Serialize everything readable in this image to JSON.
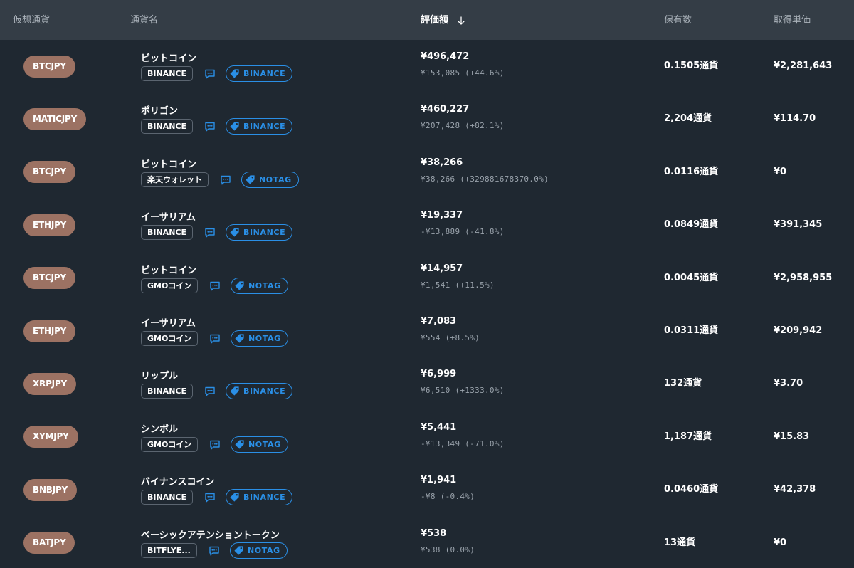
{
  "header": {
    "col_asset": "仮想通貨",
    "col_name": "通貨名",
    "col_value": "評価額",
    "col_qty": "保有数",
    "col_price": "取得単価"
  },
  "colors": {
    "header_bg": "#343d46",
    "body_bg": "#1f2831",
    "pill": "#9c7263",
    "tag_blue": "#2a8fe6"
  },
  "rows": [
    {
      "symbol": "BTCJPY",
      "name": "ビットコイン",
      "exchange": "BINANCE",
      "tag": "BINANCE",
      "value": "¥496,472",
      "gain": "¥153,085 (+44.6%)",
      "qty": "0.1505通貨",
      "price": "¥2,281,643"
    },
    {
      "symbol": "MATICJPY",
      "name": "ポリゴン",
      "exchange": "BINANCE",
      "tag": "BINANCE",
      "value": "¥460,227",
      "gain": "¥207,428 (+82.1%)",
      "qty": "2,204通貨",
      "price": "¥114.70"
    },
    {
      "symbol": "BTCJPY",
      "name": "ビットコイン",
      "exchange": "楽天ウォレット",
      "tag": "NOTAG",
      "value": "¥38,266",
      "gain": "¥38,266 (+329881678370.0%)",
      "qty": "0.0116通貨",
      "price": "¥0"
    },
    {
      "symbol": "ETHJPY",
      "name": "イーサリアム",
      "exchange": "BINANCE",
      "tag": "BINANCE",
      "value": "¥19,337",
      "gain": "-¥13,889 (-41.8%)",
      "qty": "0.0849通貨",
      "price": "¥391,345"
    },
    {
      "symbol": "BTCJPY",
      "name": "ビットコイン",
      "exchange": "GMOコイン",
      "tag": "NOTAG",
      "value": "¥14,957",
      "gain": "¥1,541 (+11.5%)",
      "qty": "0.0045通貨",
      "price": "¥2,958,955"
    },
    {
      "symbol": "ETHJPY",
      "name": "イーサリアム",
      "exchange": "GMOコイン",
      "tag": "NOTAG",
      "value": "¥7,083",
      "gain": "¥554 (+8.5%)",
      "qty": "0.0311通貨",
      "price": "¥209,942"
    },
    {
      "symbol": "XRPJPY",
      "name": "リップル",
      "exchange": "BINANCE",
      "tag": "BINANCE",
      "value": "¥6,999",
      "gain": "¥6,510 (+1333.0%)",
      "qty": "132通貨",
      "price": "¥3.70"
    },
    {
      "symbol": "XYMJPY",
      "name": "シンボル",
      "exchange": "GMOコイン",
      "tag": "NOTAG",
      "value": "¥5,441",
      "gain": "-¥13,349 (-71.0%)",
      "qty": "1,187通貨",
      "price": "¥15.83"
    },
    {
      "symbol": "BNBJPY",
      "name": "バイナンスコイン",
      "exchange": "BINANCE",
      "tag": "BINANCE",
      "value": "¥1,941",
      "gain": "-¥8 (-0.4%)",
      "qty": "0.0460通貨",
      "price": "¥42,378"
    },
    {
      "symbol": "BATJPY",
      "name": "ベーシックアテンショントークン",
      "exchange": "BITFLYE...",
      "tag": "NOTAG",
      "value": "¥538",
      "gain": "¥538 (0.0%)",
      "qty": "13通貨",
      "price": "¥0"
    }
  ]
}
